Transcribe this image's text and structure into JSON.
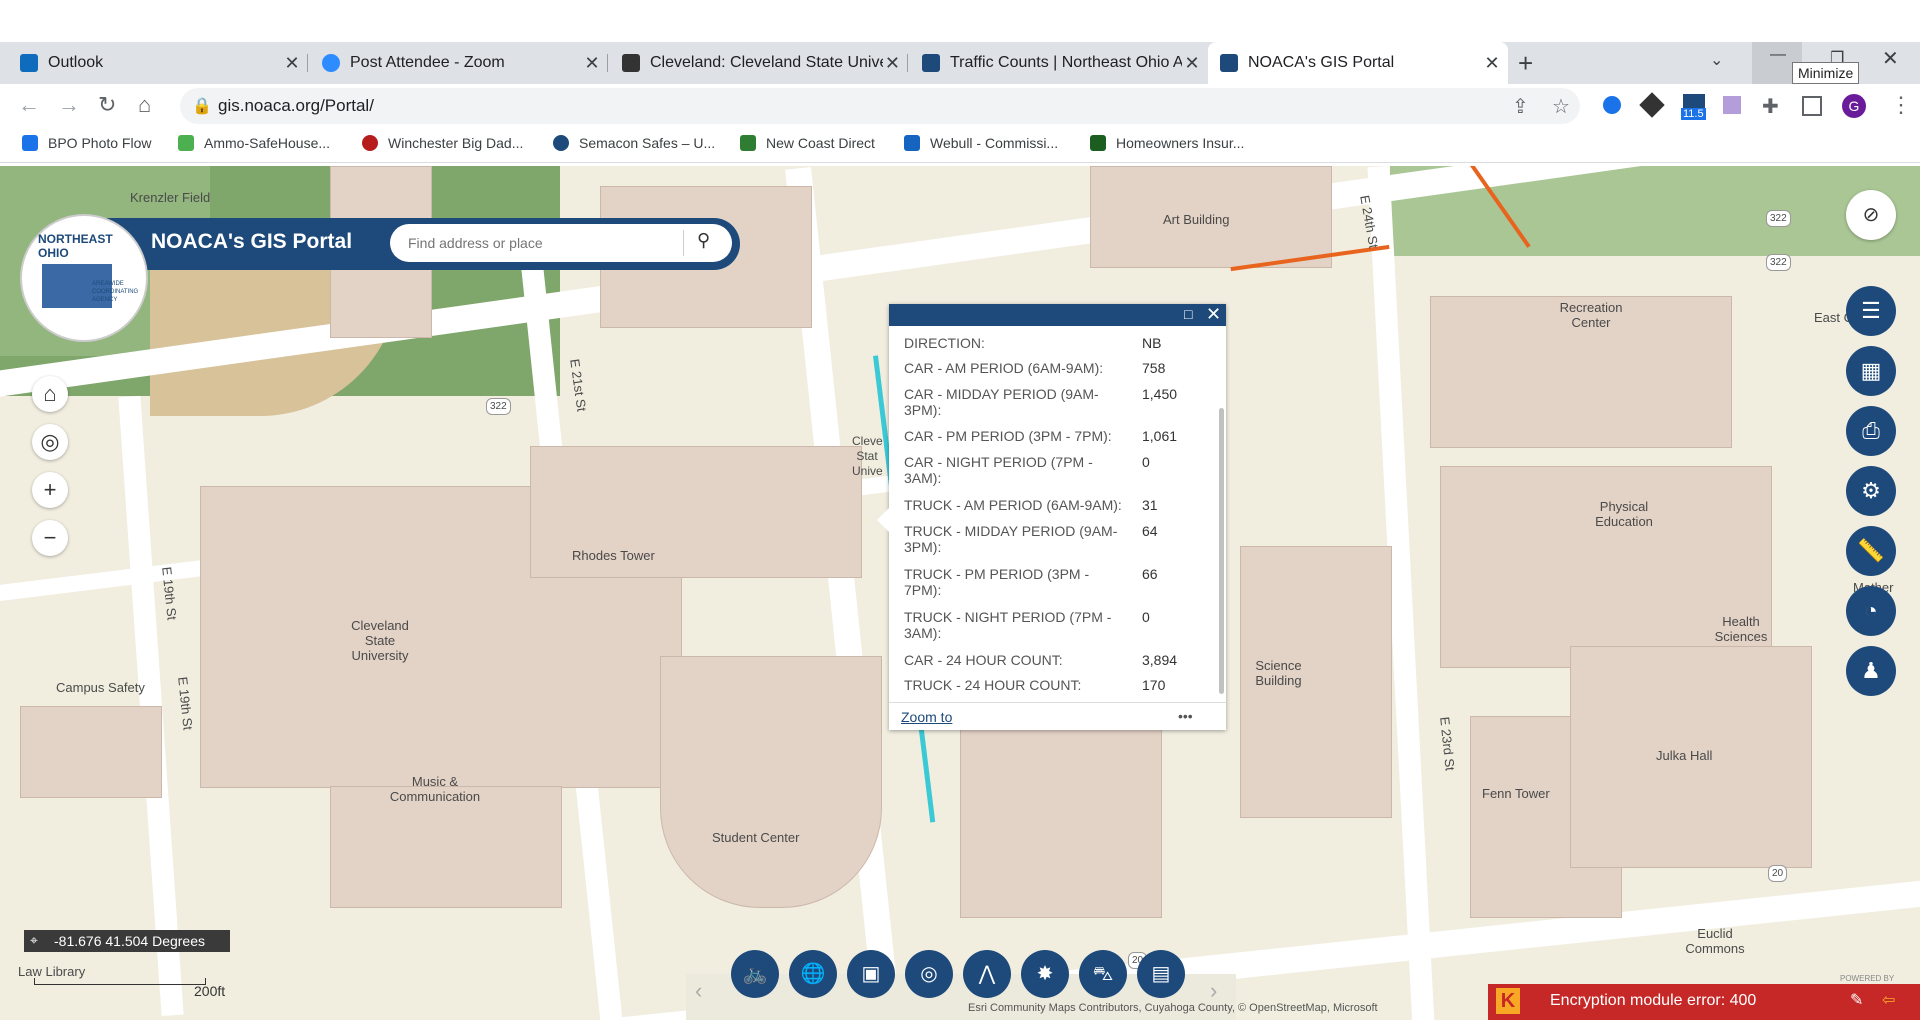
{
  "tabs": [
    {
      "title": "Outlook",
      "color": "#0f6cbd"
    },
    {
      "title": "Post Attendee - Zoom",
      "color": "#2d8cff"
    },
    {
      "title": "Cleveland: Cleveland State Univer",
      "color": "#333333"
    },
    {
      "title": "Traffic Counts | Northeast Ohio A",
      "color": "#1d4a7a"
    },
    {
      "title": "NOACA's GIS Portal",
      "color": "#1d4a7a"
    }
  ],
  "window": {
    "tooltip": "Minimize",
    "new_tab": "+"
  },
  "address": {
    "url": "gis.noaca.org/Portal/",
    "ext_badge": "11.5",
    "profile": "G"
  },
  "bookmarks": [
    {
      "label": "BPO Photo Flow",
      "color": "#1a73e8"
    },
    {
      "label": "Ammo-SafeHouse...",
      "color": "#4caf50"
    },
    {
      "label": "Winchester Big Dad...",
      "color": "#b71c1c"
    },
    {
      "label": "Semacon Safes – U...",
      "color": "#1d4a7a"
    },
    {
      "label": "New Coast Direct",
      "color": "#2e7d32"
    },
    {
      "label": "Webull - Commissi...",
      "color": "#1565c0"
    },
    {
      "label": "Homeowners Insur...",
      "color": "#1b5e20"
    }
  ],
  "portal": {
    "title": "NOACA's GIS Portal",
    "search_placeholder": "Find address or place",
    "logo_text": "NORTHEAST OHIO",
    "logo_sub": "AREAWIDE COORDINATING AGENCY"
  },
  "popup": {
    "rows": [
      {
        "label": "DIRECTION:",
        "value": "NB"
      },
      {
        "label": "CAR - AM PERIOD (6AM-9AM):",
        "value": "758"
      },
      {
        "label": "CAR - MIDDAY PERIOD (9AM-3PM):",
        "value": "1,450"
      },
      {
        "label": "CAR - PM PERIOD (3PM - 7PM):",
        "value": "1,061"
      },
      {
        "label": "CAR - NIGHT PERIOD (7PM - 3AM):",
        "value": "0"
      },
      {
        "label": "TRUCK - AM PERIOD (6AM-9AM):",
        "value": "31"
      },
      {
        "label": "TRUCK - MIDDAY PERIOD (9AM-3PM):",
        "value": "64"
      },
      {
        "label": "TRUCK - PM PERIOD (3PM - 7PM):",
        "value": "66"
      },
      {
        "label": "TRUCK - NIGHT PERIOD (7PM - 3AM):",
        "value": "0"
      },
      {
        "label": "CAR - 24 HOUR COUNT:",
        "value": "3,894"
      },
      {
        "label": "TRUCK - 24 HOUR COUNT:",
        "value": "170"
      }
    ],
    "zoom_link": "Zoom to",
    "more": "•••"
  },
  "map_labels": {
    "krenzler": "Krenzler Field",
    "art": "Art Building",
    "e24": "E 24th St",
    "recreation": "Recreation Center",
    "east_c": "East C",
    "physical": "Physical Education",
    "mather": "Mather",
    "health": "Health Sciences",
    "e21": "E 21st St",
    "rhodes": "Rhodes Tower",
    "csu": "Cleveland State University",
    "e19a": "E 19th St",
    "e19b": "E 19th St",
    "campus_safety": "Campus Safety",
    "music": "Music & Communication",
    "student": "Student Center",
    "science": "Science Building",
    "e23": "E 23rd St",
    "fenn": "Fenn Tower",
    "julka": "Julka Hall",
    "euclid": "Euclid Commons",
    "law": "Law Library",
    "cleve_partial": "Cleve Stat Unive",
    "route322a": "322",
    "route322b": "322",
    "route322c": "322",
    "route20a": "20",
    "route20b": "20"
  },
  "coords": "-81.676 41.504 Degrees",
  "scale": "200ft",
  "attribution": "Esri Community Maps Contributors, Cuyahoga County, © OpenStreetMap, Microsoft",
  "powered": "POWERED BY",
  "error_banner": "Encryption module error: 400",
  "colors": {
    "brand": "#1d4a7a",
    "traffic_line": "#3cc9d6",
    "orange_line": "#e8641e",
    "error_bg": "#c62828"
  }
}
